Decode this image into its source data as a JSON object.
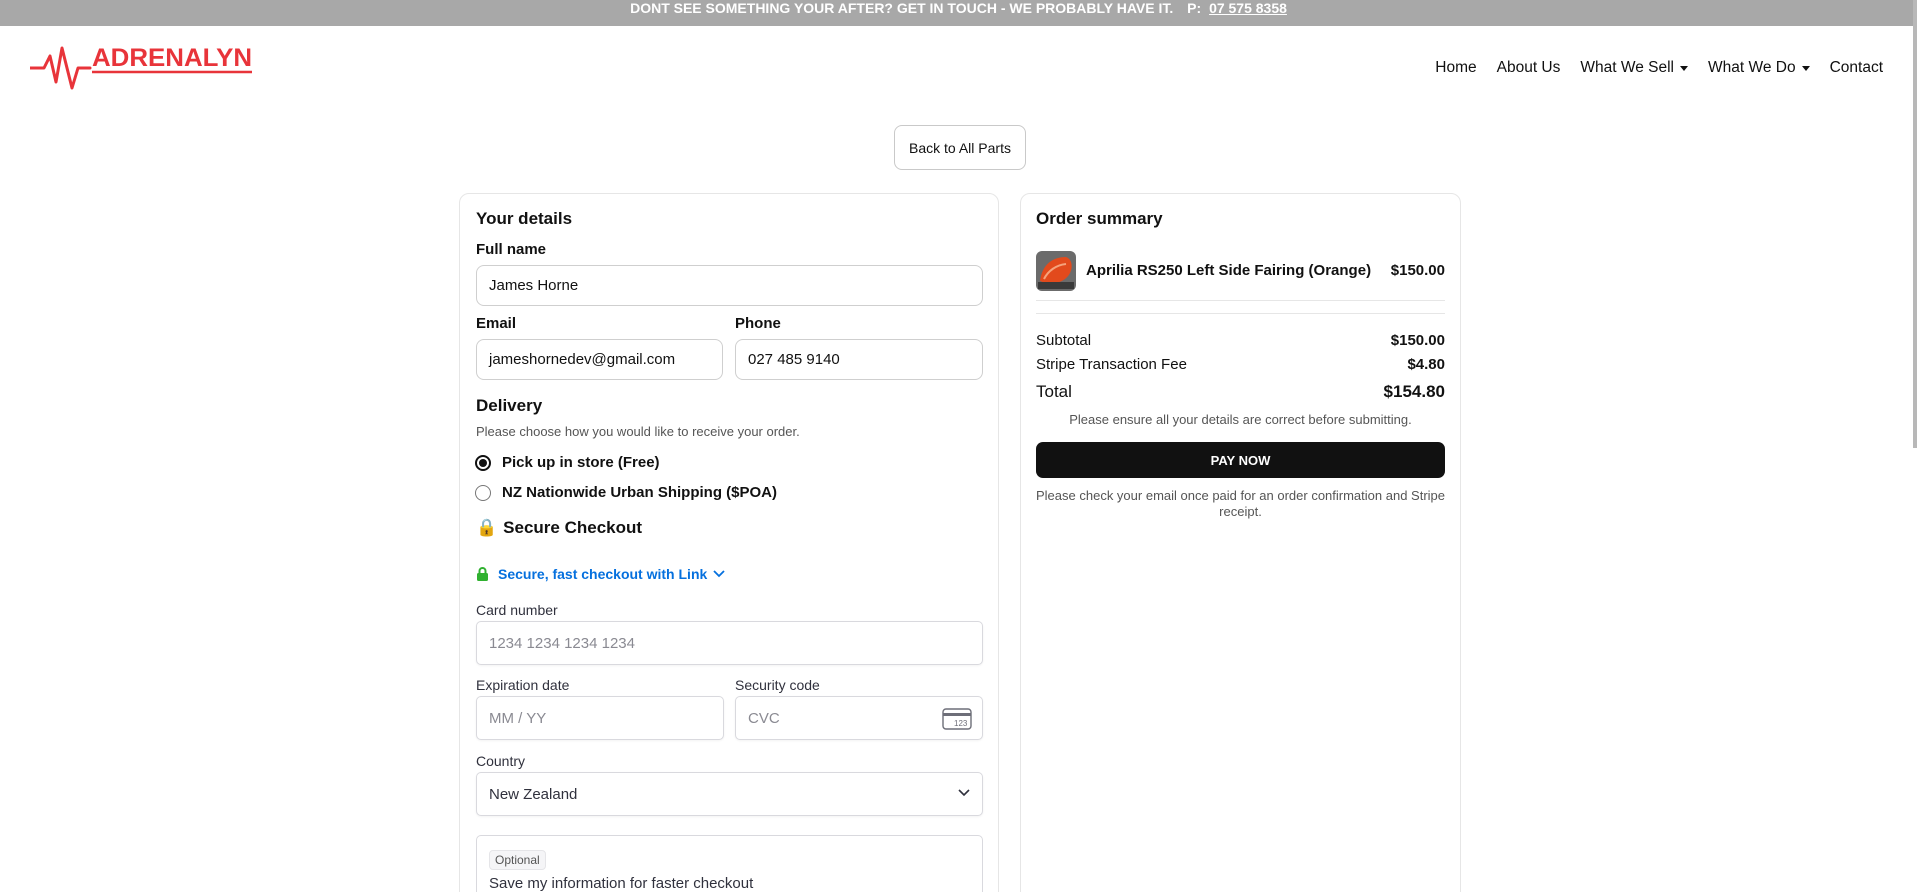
{
  "announcement": {
    "text": "DONT SEE SOMETHING YOUR AFTER? GET IN TOUCH - WE PROBABLY HAVE IT.",
    "phone_label": "P:",
    "phone": "07 575 8358"
  },
  "brand": {
    "name": "ADRENALYN",
    "color": "#e8343a"
  },
  "nav": {
    "home": "Home",
    "about": "About Us",
    "what_we_sell": "What We Sell",
    "what_we_do": "What We Do",
    "contact": "Contact"
  },
  "back_button": "Back to All Parts",
  "details": {
    "title": "Your details",
    "full_name_label": "Full name",
    "full_name": "James Horne",
    "email_label": "Email",
    "email": "jameshornedev@gmail.com",
    "phone_label": "Phone",
    "phone": "027 485 9140"
  },
  "delivery": {
    "title": "Delivery",
    "subtitle": "Please choose how you would like to receive your order.",
    "options": [
      {
        "label": "Pick up in store (Free)",
        "selected": true
      },
      {
        "label": "NZ Nationwide Urban Shipping ($POA)",
        "selected": false
      }
    ]
  },
  "checkout": {
    "lock_emoji": "🔒",
    "title": "Secure Checkout",
    "link_text": "Secure, fast checkout with Link",
    "card_number_label": "Card number",
    "card_number_placeholder": "1234 1234 1234 1234",
    "expiry_label": "Expiration date",
    "expiry_placeholder": "MM / YY",
    "cvc_label": "Security code",
    "cvc_placeholder": "CVC",
    "cvc_icon_text": "123",
    "country_label": "Country",
    "country_value": "New Zealand",
    "optional_badge": "Optional",
    "save_info": "Save my information for faster checkout"
  },
  "summary": {
    "title": "Order summary",
    "item_name": "Aprilia RS250 Left Side Fairing (Orange)",
    "item_price": "$150.00",
    "subtotal_label": "Subtotal",
    "subtotal": "$150.00",
    "fee_label": "Stripe Transaction Fee",
    "fee": "$4.80",
    "total_label": "Total",
    "total": "$154.80",
    "ensure_note": "Please ensure all your details are correct before submitting.",
    "pay_button": "PAY NOW",
    "confirm_note": "Please check your email once paid for an order confirmation and Stripe receipt."
  },
  "colors": {
    "announcement_bg": "#a8a8a8",
    "link_blue": "#0570de",
    "link_lock_green": "#30b130",
    "pay_bg": "#111111"
  }
}
